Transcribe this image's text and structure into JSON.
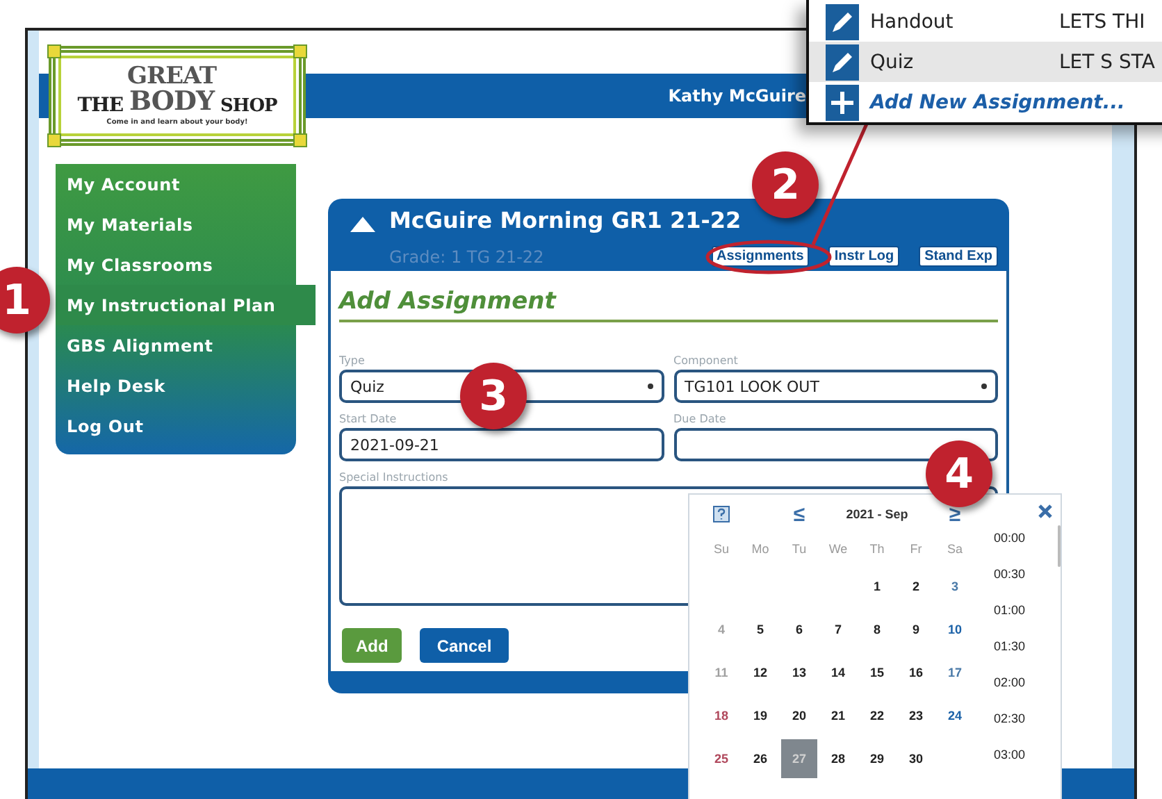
{
  "header": {
    "logo": {
      "the": "THE",
      "great": "GREAT",
      "body": "BODY",
      "shop": "SHOP",
      "tagline": "Come in and learn about your body!"
    },
    "user": "Kathy McGuire"
  },
  "sidebar": {
    "items": [
      {
        "label": "My Account",
        "selected": false
      },
      {
        "label": "My Materials",
        "selected": false
      },
      {
        "label": "My Classrooms",
        "selected": false
      },
      {
        "label": "My Instructional Plan",
        "selected": true
      },
      {
        "label": "GBS Alignment",
        "selected": false
      },
      {
        "label": "Help Desk",
        "selected": false
      },
      {
        "label": "Log Out",
        "selected": false
      }
    ]
  },
  "panel": {
    "title": "McGuire Morning GR1 21-22",
    "subtitle": "Grade: 1 TG 21-22",
    "tabs": [
      "Assignments",
      "Instr Log",
      "Stand Exp"
    ],
    "heading": "Add Assignment",
    "fields": [
      {
        "kind": "select",
        "label": "Type",
        "value": "Quiz"
      },
      {
        "kind": "select",
        "label": "Component",
        "value": "TG101 LOOK OUT"
      },
      {
        "kind": "text",
        "label": "Start Date",
        "value": "2021-09-21"
      },
      {
        "kind": "text",
        "label": "Due Date"
      },
      {
        "kind": "textarea",
        "label": "Special Instructions"
      }
    ],
    "buttons": [
      {
        "kind": "primary",
        "label": "Add"
      },
      {
        "kind": "secondary",
        "label": "Cancel"
      }
    ]
  },
  "calendar": {
    "prev": "≤",
    "month": "2021 - Sep",
    "next": "≥",
    "weekdays": [
      "Su",
      "Mo",
      "Tu",
      "We",
      "Th",
      "Fr",
      "Sa"
    ],
    "weeks": [
      {
        "kind": "first",
        "days": [
          {
            "label": "1",
            "color": "#222222",
            "selected": false
          },
          {
            "label": "2",
            "color": "#222222",
            "selected": false
          },
          {
            "label": "3",
            "color": "#4a7aa8",
            "selected": false
          }
        ]
      },
      {
        "kind": "full",
        "days": [
          {
            "label": "4",
            "color": "#a0a0a0",
            "selected": false
          },
          {
            "label": "5",
            "color": "#222222",
            "selected": false
          },
          {
            "label": "6",
            "color": "#222222",
            "selected": false
          },
          {
            "label": "7",
            "color": "#222222",
            "selected": false
          },
          {
            "label": "8",
            "color": "#222222",
            "selected": false
          },
          {
            "label": "9",
            "color": "#222222",
            "selected": false
          },
          {
            "label": "10",
            "color": "#1c62a8",
            "selected": false
          }
        ]
      },
      {
        "kind": "full",
        "days": [
          {
            "label": "11",
            "color": "#a0a0a0",
            "selected": false
          },
          {
            "label": "12",
            "color": "#222222",
            "selected": false
          },
          {
            "label": "13",
            "color": "#222222",
            "selected": false
          },
          {
            "label": "14",
            "color": "#222222",
            "selected": false
          },
          {
            "label": "15",
            "color": "#222222",
            "selected": false
          },
          {
            "label": "16",
            "color": "#222222",
            "selected": false
          },
          {
            "label": "17",
            "color": "#4a7aa8",
            "selected": false
          }
        ]
      },
      {
        "kind": "full",
        "days": [
          {
            "label": "18",
            "color": "#b0485c",
            "selected": false
          },
          {
            "label": "19",
            "color": "#222222",
            "selected": false
          },
          {
            "label": "20",
            "color": "#222222",
            "selected": false
          },
          {
            "label": "21",
            "color": "#222222",
            "selected": false
          },
          {
            "label": "22",
            "color": "#222222",
            "selected": false
          },
          {
            "label": "23",
            "color": "#222222",
            "selected": false
          },
          {
            "label": "24",
            "color": "#1c62a8",
            "selected": false
          }
        ]
      },
      {
        "kind": "last",
        "days": [
          {
            "label": "25",
            "color": "#b0485c",
            "selected": false
          },
          {
            "label": "26",
            "color": "#222222",
            "selected": false
          },
          {
            "label": "27",
            "selected": true
          },
          {
            "label": "28",
            "color": "#222222",
            "selected": false
          },
          {
            "label": "29",
            "color": "#222222",
            "selected": false
          },
          {
            "label": "30",
            "color": "#222222",
            "selected": false
          }
        ]
      }
    ],
    "times": [
      "00:00",
      "00:30",
      "01:00",
      "01:30",
      "02:00",
      "02:30",
      "03:00"
    ]
  },
  "popup": {
    "rows": [
      {
        "kind": "edit",
        "name": "Handout",
        "component": "LETS THI",
        "selected": false
      },
      {
        "kind": "edit",
        "name": "Quiz",
        "component": "LET S STA",
        "selected": true
      },
      {
        "kind": "add",
        "name": "Add New Assignment...",
        "selected": false
      }
    ]
  },
  "callouts": [
    "1",
    "2",
    "3",
    "4"
  ]
}
